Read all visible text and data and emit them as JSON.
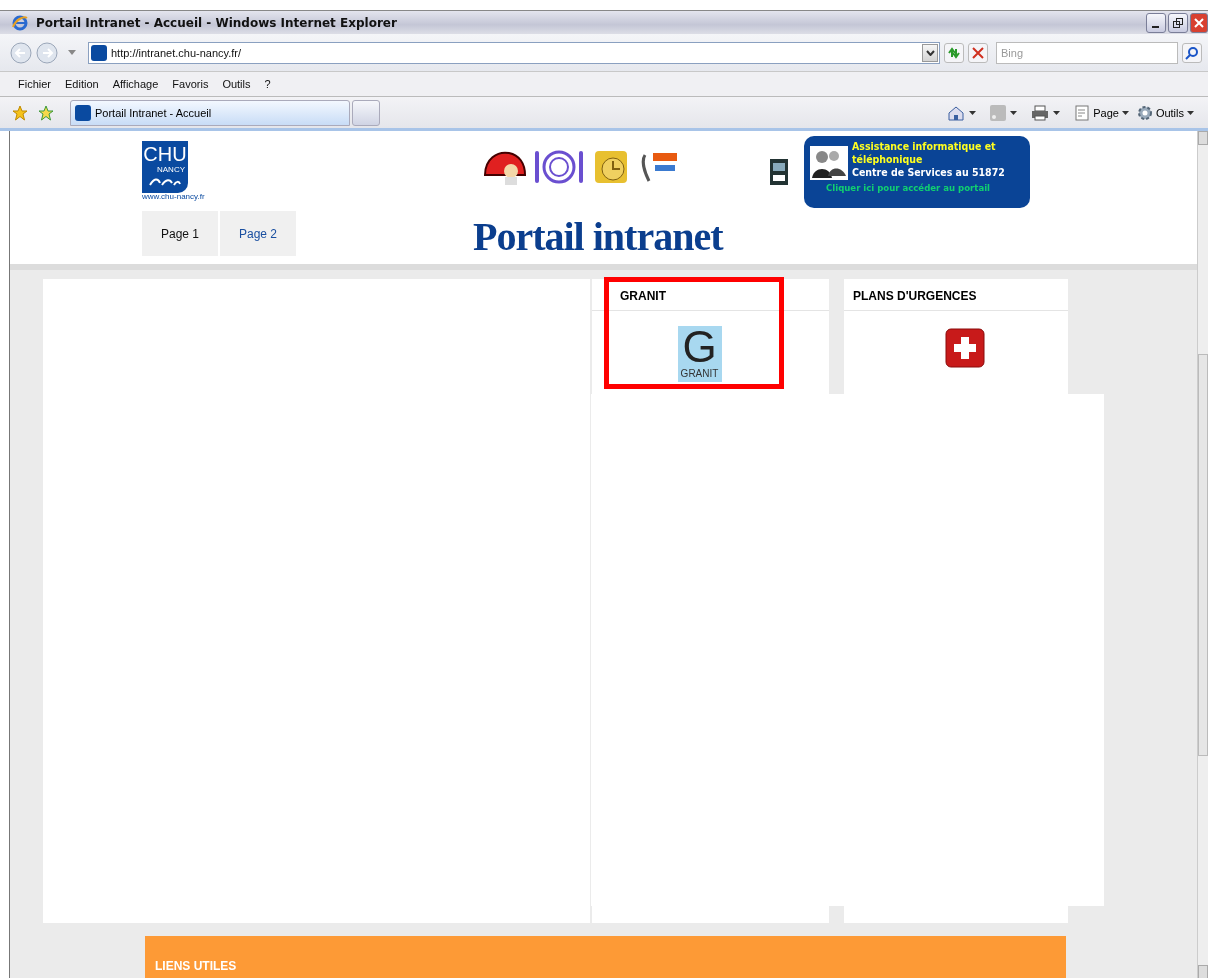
{
  "window": {
    "title": "Portail Intranet - Accueil - Windows Internet Explorer"
  },
  "address_bar": {
    "url": "http://intranet.chu-nancy.fr/"
  },
  "search": {
    "placeholder": "Bing"
  },
  "menu": [
    "Fichier",
    "Edition",
    "Affichage",
    "Favoris",
    "Outils",
    "?"
  ],
  "tabs": [
    {
      "label": "Portail Intranet - Accueil",
      "selected": true
    }
  ],
  "command_bar": [
    "Page",
    "Outils"
  ],
  "page": {
    "logo": {
      "title": "CHU",
      "subtitle": "NANCY",
      "url": "www.chu-nancy.fr"
    },
    "assistance": {
      "title": "Assistance informatique et téléphonique",
      "phone": "Centre de Services au 51872",
      "link": "Cliquer ici pour accéder au portail"
    },
    "page_tabs": [
      {
        "label": "Page 1",
        "selected": true
      },
      {
        "label": "Page 2",
        "selected": false
      }
    ],
    "heading": "Portail intranet",
    "cards": [
      {
        "title": "GRANIT",
        "highlighted": true,
        "kind": "granit",
        "logo_letter": "G",
        "logo_caption": "GRANIT"
      },
      {
        "title": "PLANS D'URGENCES",
        "highlighted": false,
        "kind": "emergency"
      }
    ],
    "footer": {
      "title": "LIENS UTILES"
    }
  }
}
